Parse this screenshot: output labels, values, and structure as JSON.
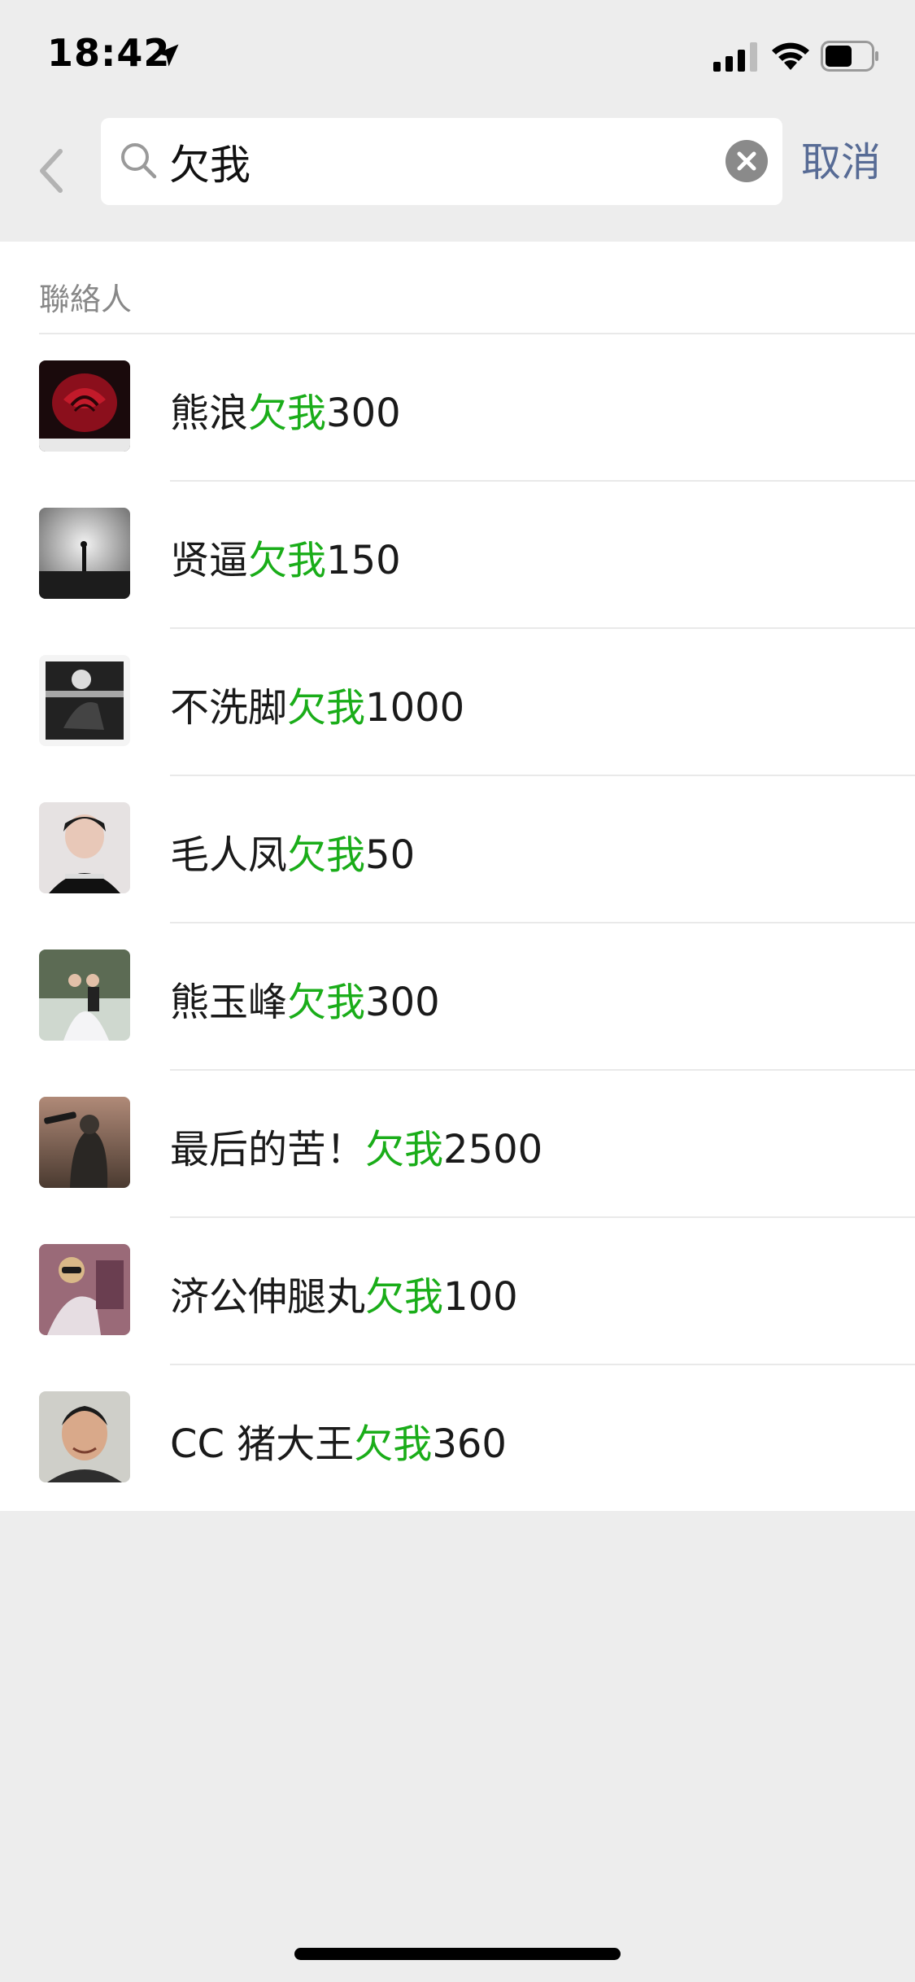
{
  "status_bar": {
    "time": "18:42",
    "icons": [
      "location-arrow-icon",
      "cellular-signal-icon",
      "wifi-icon",
      "battery-icon"
    ]
  },
  "search": {
    "back_icon": "chevron-left-icon",
    "search_icon": "magnifier-icon",
    "value": "欠我",
    "clear_icon": "clear-circle-icon",
    "cancel_label": "取消"
  },
  "results": {
    "section_title": "聯絡人",
    "highlight_color": "#1aad19",
    "contacts": [
      {
        "prefix": "熊浪",
        "match": "欠我",
        "suffix": "300"
      },
      {
        "prefix": "贤逼",
        "match": "欠我",
        "suffix": "150"
      },
      {
        "prefix": "不洗脚",
        "match": "欠我",
        "suffix": "1000"
      },
      {
        "prefix": "毛人凤",
        "match": "欠我",
        "suffix": "50"
      },
      {
        "prefix": "熊玉峰",
        "match": "欠我",
        "suffix": "300"
      },
      {
        "prefix": "最后的苦！",
        "match": "欠我",
        "suffix": "2500"
      },
      {
        "prefix": "济公伸腿丸",
        "match": "欠我",
        "suffix": "100"
      },
      {
        "prefix": "CC 猪大王",
        "match": "欠我",
        "suffix": "360"
      }
    ]
  },
  "colors": {
    "accent_link": "#576b95",
    "background": "#ededed"
  }
}
